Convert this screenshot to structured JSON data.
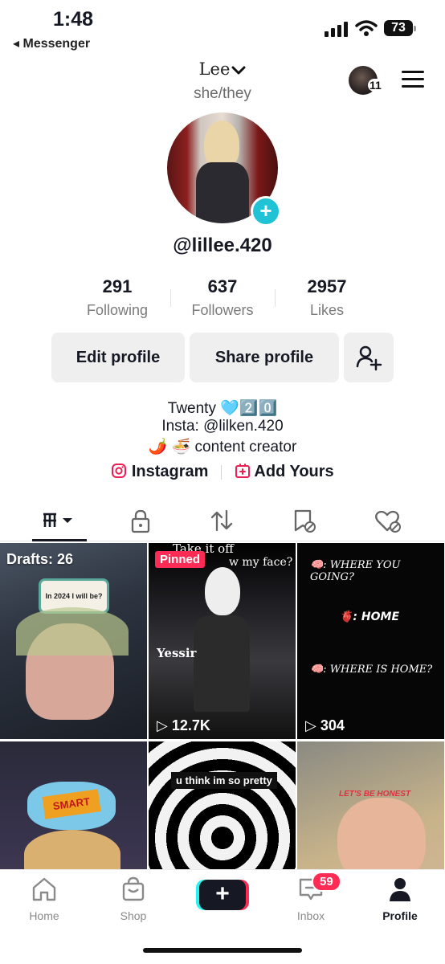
{
  "status_bar": {
    "time": "1:48",
    "back_app": "Messenger",
    "battery": "73"
  },
  "header": {
    "display_name": "Lee",
    "pronouns": "she/they",
    "notification_count": "11"
  },
  "profile": {
    "handle": "@lillee.420",
    "stats": [
      {
        "value": "291",
        "label": "Following"
      },
      {
        "value": "637",
        "label": "Followers"
      },
      {
        "value": "2957",
        "label": "Likes"
      }
    ],
    "buttons": {
      "edit": "Edit profile",
      "share": "Share profile"
    },
    "bio": [
      "Twenty 🩵2️⃣0️⃣",
      "Insta: @lilken.420",
      "🌶️ 🍜 content creator"
    ],
    "links": {
      "instagram": "Instagram",
      "add_yours": "Add Yours"
    }
  },
  "grid": {
    "drafts_label": "Drafts: 26",
    "pinned_label": "Pinned",
    "videos": [
      {
        "caption": "In 2024 I will be?"
      },
      {
        "caption_top": "Take it off",
        "caption_mid": "w my face?",
        "caption_side": "Yessir",
        "views": "12.7K"
      },
      {
        "line1": "🧠: WHERE YOU GOING?",
        "line2": "🫀: HOME",
        "line3": "🧠: WHERE IS HOME?",
        "views": "304"
      },
      {
        "caption": "SMART"
      },
      {
        "caption": "u think im so pretty"
      },
      {
        "caption": "LET'S BE HONEST"
      }
    ]
  },
  "bottom_nav": {
    "home": "Home",
    "shop": "Shop",
    "create": "+",
    "inbox": "Inbox",
    "inbox_badge": "59",
    "profile": "Profile"
  }
}
